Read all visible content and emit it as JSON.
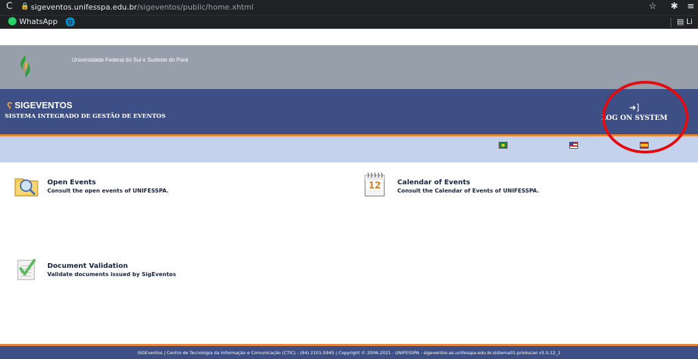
{
  "browser": {
    "url_host": "sigeventos.unifesspa.edu.br",
    "url_path": "/sigeventos/public/home.xhtml",
    "bookmarks": [
      {
        "label": "WhatsApp"
      }
    ],
    "reading_list": "Li"
  },
  "header": {
    "university": "Universidade Federal do Sul e Sudeste do Pará",
    "brand": "SIGEVENTOS",
    "subtitle": "SISTEMA INTEGRADO DE GESTÃO DE EVENTOS",
    "logon_label": "LOG ON SYSTEM"
  },
  "colors": {
    "header_top": "#979fab",
    "header_main": "#3e4f86",
    "accent_orange": "#e6883a",
    "lang_bar": "#c5d2ec",
    "annotation_red": "#e30b10"
  },
  "menu": {
    "open_events": {
      "title": "Open Events",
      "desc": "Consult the open events of UNIFESSPA."
    },
    "calendar": {
      "title": "Calendar of Events",
      "desc": "Consult the Calendar of Events of UNIFESSPA.",
      "icon_number": "12"
    },
    "validation": {
      "title": "Document Validation",
      "desc": "Validate documents issued by SigEventos"
    }
  },
  "footer": {
    "text": "SIGEventos | Centro de Tecnologia da Informação e Comunicação (CTIC) - (94) 2101-5945 | Copyright © 2006-2021 - UNIFESSPA - sigeventos-as.unifesspa.edu.br.sistema01-producao v5.0.12_1"
  }
}
